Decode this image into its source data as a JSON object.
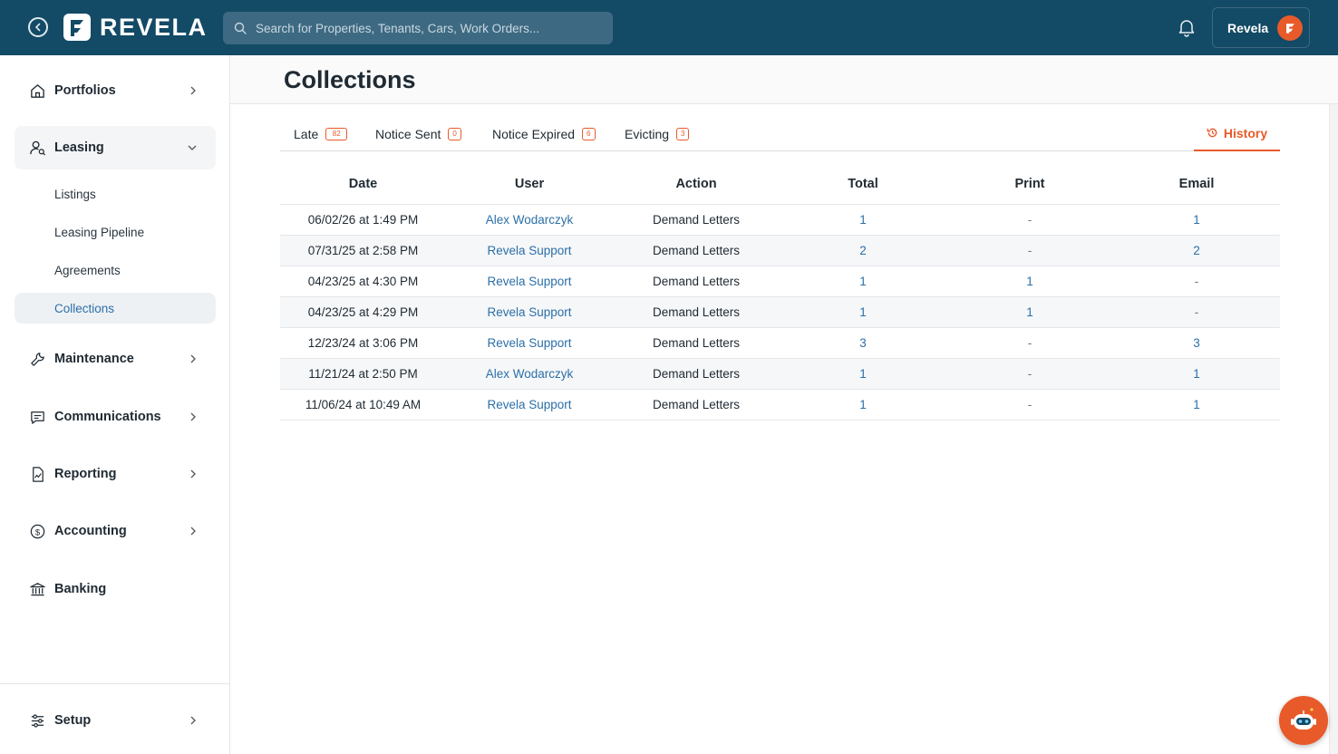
{
  "brand": {
    "name": "REVELA",
    "accent": "#e85a2a",
    "header_bg": "#134a66",
    "link": "#2b6fa8"
  },
  "search": {
    "placeholder": "Search for Properties, Tenants, Cars, Work Orders..."
  },
  "user": {
    "name": "Revela"
  },
  "sidebar": {
    "items": [
      {
        "label": "Portfolios",
        "icon": "home-icon"
      },
      {
        "label": "Leasing",
        "icon": "user-search-icon"
      },
      {
        "label": "Maintenance",
        "icon": "wrench-icon"
      },
      {
        "label": "Communications",
        "icon": "chat-icon"
      },
      {
        "label": "Reporting",
        "icon": "report-icon"
      },
      {
        "label": "Accounting",
        "icon": "dollar-icon"
      },
      {
        "label": "Banking",
        "icon": "bank-icon"
      }
    ],
    "leasing_sub": [
      {
        "label": "Listings"
      },
      {
        "label": "Leasing Pipeline"
      },
      {
        "label": "Agreements"
      },
      {
        "label": "Collections"
      }
    ],
    "setup": {
      "label": "Setup",
      "icon": "sliders-icon"
    }
  },
  "page": {
    "title": "Collections"
  },
  "tabs": [
    {
      "label": "Late",
      "count": "82"
    },
    {
      "label": "Notice Sent",
      "count": "0"
    },
    {
      "label": "Notice Expired",
      "count": "6"
    },
    {
      "label": "Evicting",
      "count": "3"
    }
  ],
  "history_tab": {
    "label": "History"
  },
  "table": {
    "headers": [
      "Date",
      "User",
      "Action",
      "Total",
      "Print",
      "Email"
    ],
    "rows": [
      [
        "06/02/26 at 1:49 PM",
        "Alex Wodarczyk",
        "Demand Letters",
        "1",
        "-",
        "1"
      ],
      [
        "07/31/25 at 2:58 PM",
        "Revela Support",
        "Demand Letters",
        "2",
        "-",
        "2"
      ],
      [
        "04/23/25 at 4:30 PM",
        "Revela Support",
        "Demand Letters",
        "1",
        "1",
        "-"
      ],
      [
        "04/23/25 at 4:29 PM",
        "Revela Support",
        "Demand Letters",
        "1",
        "1",
        "-"
      ],
      [
        "12/23/24 at 3:06 PM",
        "Revela Support",
        "Demand Letters",
        "3",
        "-",
        "3"
      ],
      [
        "11/21/24 at 2:50 PM",
        "Alex Wodarczyk",
        "Demand Letters",
        "1",
        "-",
        "1"
      ],
      [
        "11/06/24 at 10:49 AM",
        "Revela Support",
        "Demand Letters",
        "1",
        "-",
        "1"
      ]
    ]
  }
}
